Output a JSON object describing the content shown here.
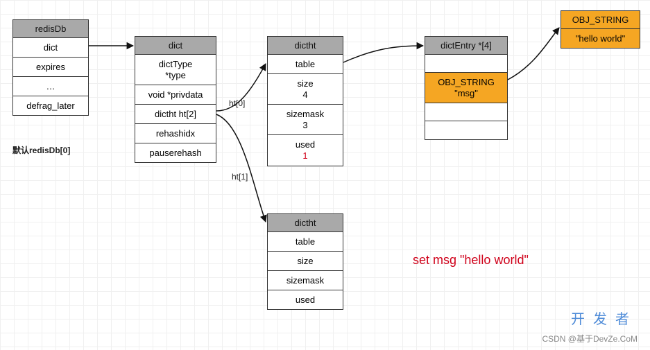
{
  "redisDb": {
    "title": "redisDb",
    "rows": [
      "dict",
      "expires",
      "…",
      "defrag_later"
    ]
  },
  "defaultLabel": "默认redisDb[0]",
  "dict": {
    "title": "dict",
    "rows": [
      "dictType\n*type",
      "void *privdata",
      "dictht ht[2]",
      "rehashidx",
      "pauserehash"
    ]
  },
  "htLabels": {
    "ht0": "ht[0]",
    "ht1": "ht[1]"
  },
  "dictht0": {
    "title": "dictht",
    "rows": [
      {
        "l1": "table"
      },
      {
        "l1": "size",
        "l2": "4"
      },
      {
        "l1": "sizemask",
        "l2": "3"
      },
      {
        "l1": "used",
        "l2": "1",
        "l2Red": true
      }
    ]
  },
  "dictEntry": {
    "title": "dictEntry *[4]",
    "rows": [
      {
        "blank": true
      },
      {
        "orange": true,
        "l1": "OBJ_STRING",
        "l2": "\"msg\""
      },
      {
        "blank": true
      },
      {
        "blank": true
      }
    ]
  },
  "objString": {
    "title": "OBJ_STRING",
    "row": "\"hello world\""
  },
  "dictht1": {
    "title": "dictht",
    "rows": [
      "table",
      "size",
      "sizemask",
      "used"
    ]
  },
  "command": "set msg \"hello world\"",
  "watermarks": {
    "site": "开发者",
    "sub": "CSDN @基于DevZe.CoM"
  }
}
